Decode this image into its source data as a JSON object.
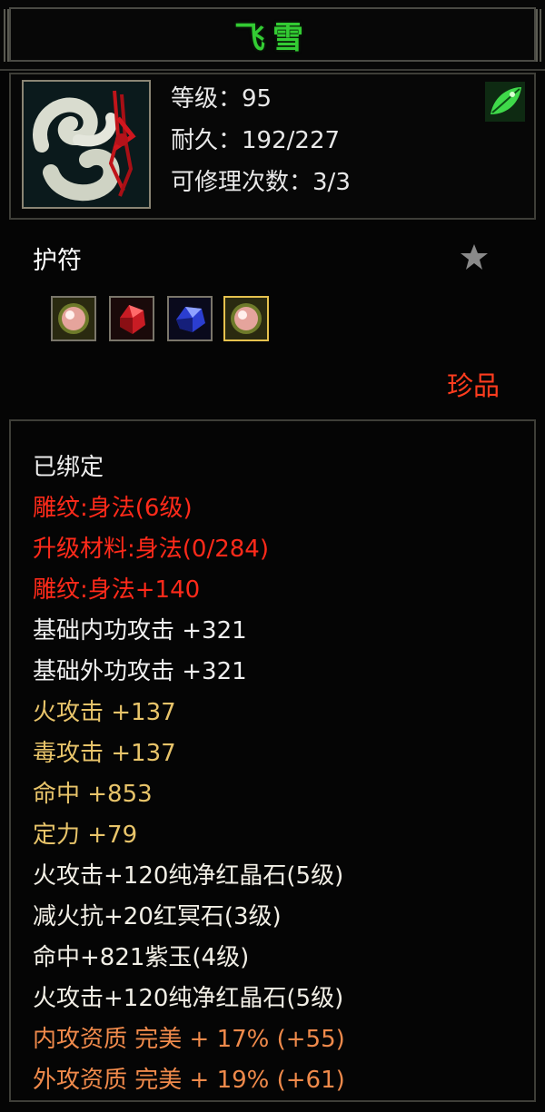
{
  "title": "飞雪",
  "stats": {
    "level_label": "等级：",
    "level": "95",
    "durability_label": "耐久：",
    "durability": "192/227",
    "repairs_label": "可修理次数：",
    "repairs": "3/3"
  },
  "category": "护符",
  "rarity": "珍品",
  "gems": [
    {
      "type": "pink-gem",
      "border": "normal"
    },
    {
      "type": "red-crystal",
      "border": "normal"
    },
    {
      "type": "blue-sapphire",
      "border": "normal"
    },
    {
      "type": "pink-gem",
      "border": "gold"
    }
  ],
  "attributes": [
    {
      "text": "已绑定",
      "color": "white"
    },
    {
      "text": "雕纹:身法(6级)",
      "color": "red"
    },
    {
      "text": "升级材料:身法(0/284)",
      "color": "red"
    },
    {
      "text": "雕纹:身法+140",
      "color": "red"
    },
    {
      "text": "基础内功攻击 +321",
      "color": "white"
    },
    {
      "text": "基础外功攻击 +321",
      "color": "white"
    },
    {
      "text": "火攻击 +137",
      "color": "gold"
    },
    {
      "text": "毒攻击 +137",
      "color": "gold"
    },
    {
      "text": "命中 +853",
      "color": "gold"
    },
    {
      "text": "定力 +79",
      "color": "gold"
    },
    {
      "text": "火攻击+120纯净红晶石(5级)",
      "color": "cream"
    },
    {
      "text": "减火抗+20红冥石(3级)",
      "color": "cream"
    },
    {
      "text": "命中+821紫玉(4级)",
      "color": "cream"
    },
    {
      "text": "火攻击+120纯净红晶石(5级)",
      "color": "cream"
    },
    {
      "text": "内攻资质 完美 + 17% (+55)",
      "color": "orange"
    },
    {
      "text": "外攻资质 完美 + 19% (+61)",
      "color": "orange"
    }
  ],
  "colors": {
    "title": "#33cc33",
    "red": "#ff2a1a",
    "gold": "#e8c46a",
    "orange": "#f08a4b",
    "rarity": "#ff3c1e"
  }
}
